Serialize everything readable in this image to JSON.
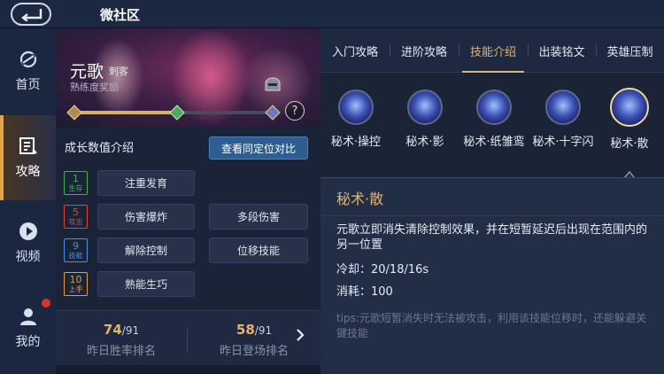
{
  "header": {
    "title": "微社区"
  },
  "nav": {
    "items": [
      {
        "label": "首页",
        "icon": "home-swirl-icon"
      },
      {
        "label": "攻略",
        "icon": "guide-icon"
      },
      {
        "label": "视频",
        "icon": "video-play-icon"
      },
      {
        "label": "我的",
        "icon": "user-icon"
      }
    ],
    "active": "攻略"
  },
  "hero": {
    "name": "元歌",
    "role": "刺客",
    "sub": "熟练度奖励",
    "progress": 0.5,
    "help": "?"
  },
  "growth": {
    "title": "成长数值介绍",
    "compare_button": "查看同定位对比",
    "tiers": [
      {
        "num": "1",
        "label": "生存",
        "color": "#3fb24a"
      },
      {
        "num": "5",
        "label": "攻击",
        "color": "#e0453a"
      },
      {
        "num": "9",
        "label": "技能",
        "color": "#4a8fe0"
      },
      {
        "num": "10",
        "label": "上手",
        "color": "#e0a040"
      }
    ],
    "tags": [
      "注重发育",
      "伤害爆炸",
      "多段伤害",
      "解除控制",
      "位移技能",
      "熟能生巧"
    ]
  },
  "ranks": {
    "win_rank": "74",
    "win_total": "/91",
    "win_label": "昨日胜率排名",
    "appear_rank": "58",
    "appear_total": "/91",
    "appear_label": "昨日登场排名"
  },
  "tabs": [
    "入门攻略",
    "进阶攻略",
    "技能介绍",
    "出装铭文",
    "英雄压制"
  ],
  "active_tab": "技能介绍",
  "skills": [
    {
      "name": "秘术·操控",
      "icon": "puppet-control-icon"
    },
    {
      "name": "秘术·影",
      "icon": "shadow-claw-icon"
    },
    {
      "name": "秘术·纸雏鸾",
      "icon": "paper-bird-icon"
    },
    {
      "name": "秘术·十字闪",
      "icon": "cross-slash-icon"
    },
    {
      "name": "秘术·散",
      "icon": "dispel-icon"
    }
  ],
  "selected_skill": "秘术·散",
  "detail": {
    "name": "秘术·散",
    "description": "元歌立即消失清除控制效果，并在短暂延迟后出现在范围内的另一位置",
    "cooldown": "冷却：20/18/16s",
    "cost": "消耗：100",
    "tips": "tips:元歌短暂消失时无法被攻击，利用该技能位移时，还能躲避关键技能"
  },
  "colors": {
    "accent": "#e4b56a",
    "compare_button": "#2e5d92",
    "notification": "#e0302a"
  }
}
